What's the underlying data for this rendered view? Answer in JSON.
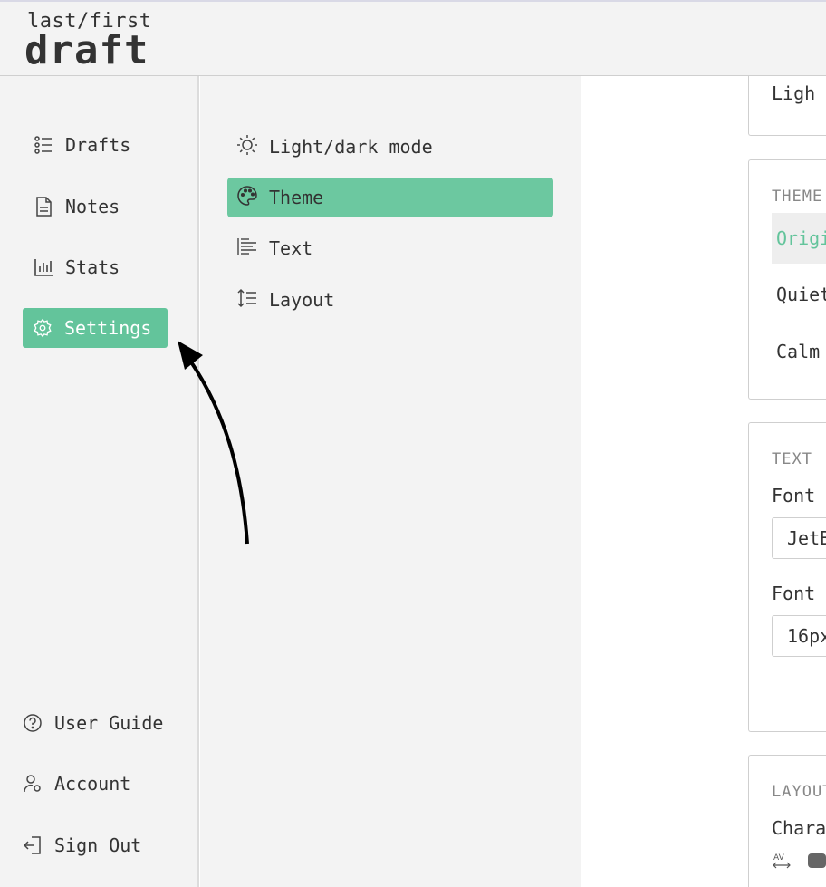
{
  "header": {
    "logo_top": "last/first",
    "logo_main": "draft"
  },
  "sidebar": {
    "items": [
      {
        "label": "Drafts",
        "icon": "list-icon"
      },
      {
        "label": "Notes",
        "icon": "file-icon"
      },
      {
        "label": "Stats",
        "icon": "bar-chart-icon"
      },
      {
        "label": "Settings",
        "icon": "gear-icon",
        "active": true
      }
    ],
    "bottom_items": [
      {
        "label": "User Guide",
        "icon": "help-circle-icon"
      },
      {
        "label": "Account",
        "icon": "user-cog-icon"
      },
      {
        "label": "Sign Out",
        "icon": "sign-out-icon"
      }
    ]
  },
  "settings_menu": {
    "items": [
      {
        "label": "Light/dark mode",
        "icon": "sun-icon"
      },
      {
        "label": "Theme",
        "icon": "palette-icon",
        "active": true
      },
      {
        "label": "Text",
        "icon": "text-align-icon"
      },
      {
        "label": "Layout",
        "icon": "line-height-icon"
      }
    ]
  },
  "content": {
    "mode_value": "Ligh",
    "theme_panel": {
      "label": "THEME",
      "options": [
        "Origi",
        "Quiet",
        "Calm "
      ]
    },
    "text_panel": {
      "label": "TEXT",
      "font_label": "Font",
      "font_value": "JetB",
      "font_size_label": "Font",
      "font_size_value": "16px"
    },
    "layout_panel": {
      "label": "LAYOUT",
      "char_label": "Chara"
    }
  },
  "colors": {
    "accent": "#63c49b",
    "sidebar_bg": "#f3f3f3",
    "border": "#cfcfcf"
  }
}
